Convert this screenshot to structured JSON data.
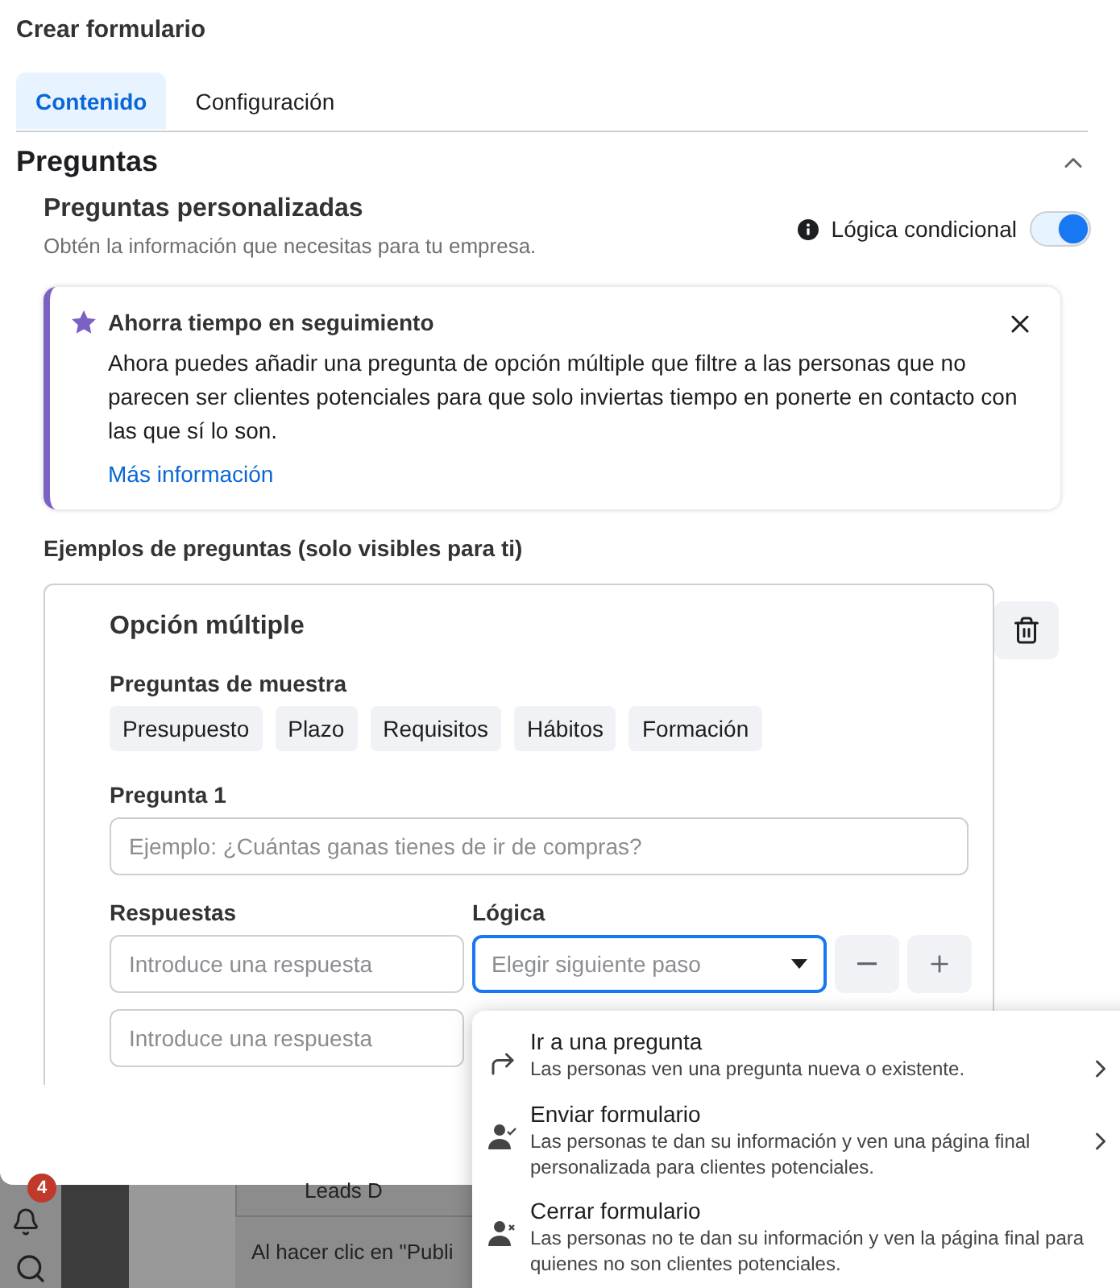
{
  "dialog": {
    "title": "Crear formulario"
  },
  "tabs": [
    {
      "label": "Contenido",
      "selected": true
    },
    {
      "label": "Configuración",
      "selected": false
    }
  ],
  "section": {
    "title": "Preguntas",
    "expanded": true
  },
  "custom": {
    "title": "Preguntas personalizadas",
    "subtitle": "Obtén la información que necesitas para tu empresa.",
    "toggle_label": "Lógica condicional",
    "toggle_on": true
  },
  "notice": {
    "title": "Ahorra tiempo en seguimiento",
    "body": "Ahora puedes añadir una pregunta de opción múltiple que filtre a las personas que no parecen ser clientes potenciales para que solo inviertas tiempo en ponerte en contacto con las que sí lo son.",
    "link": "Más información"
  },
  "examples_label": "Ejemplos de preguntas (solo visibles para ti)",
  "question_card": {
    "type_title": "Opción múltiple",
    "samples_label": "Preguntas de muestra",
    "samples": [
      "Presupuesto",
      "Plazo",
      "Requisitos",
      "Hábitos",
      "Formación"
    ],
    "question_label": "Pregunta 1",
    "question_placeholder": "Ejemplo: ¿Cuántas ganas tienes de ir de compras?",
    "answers_label": "Respuestas",
    "logic_label": "Lógica",
    "answers": [
      {
        "placeholder": "Introduce una respuesta",
        "logic_placeholder": "Elegir siguiente paso"
      },
      {
        "placeholder": "Introduce una respuesta"
      }
    ]
  },
  "menu": [
    {
      "kind": "goto",
      "title": "Ir a una pregunta",
      "description": "Las personas ven una pregunta nueva o existente.",
      "has_submenu": true
    },
    {
      "kind": "submit",
      "title": "Enviar formulario",
      "description": "Las personas te dan su información y ven una página final personalizada para clientes potenciales.",
      "has_submenu": true
    },
    {
      "kind": "close",
      "title": "Cerrar formulario",
      "description": "Las personas no te dan su información y ven la página final para quienes no son clientes potenciales.",
      "has_submenu": false
    }
  ],
  "background": {
    "badge": "4",
    "item_text": "Leads D",
    "caption": "Al hacer clic en \"Publi"
  }
}
